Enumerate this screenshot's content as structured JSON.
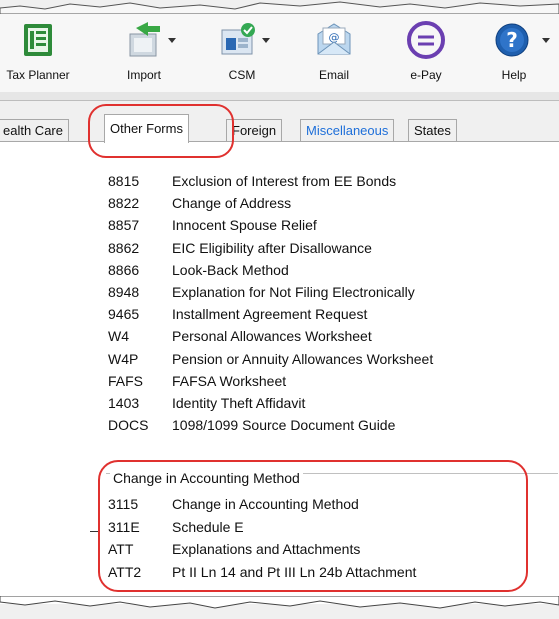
{
  "toolbar": {
    "items": [
      {
        "label": "Tax Planner",
        "icon": "tax-planner-icon"
      },
      {
        "label": "Import",
        "icon": "import-icon"
      },
      {
        "label": "CSM",
        "icon": "csm-icon"
      },
      {
        "label": "Email",
        "icon": "email-icon"
      },
      {
        "label": "e-Pay",
        "icon": "epay-icon"
      },
      {
        "label": "Help",
        "icon": "help-icon"
      }
    ]
  },
  "tabs": [
    {
      "label": "ealth Care",
      "active": false,
      "color": "#111111"
    },
    {
      "label": "Other Forms",
      "active": true,
      "color": "#111111"
    },
    {
      "label": "Foreign",
      "active": false,
      "color": "#111111"
    },
    {
      "label": "Miscellaneous",
      "active": false,
      "color": "#1e6fd9"
    },
    {
      "label": "States",
      "active": false,
      "color": "#111111"
    }
  ],
  "forms": [
    {
      "code": "8815",
      "desc": "Exclusion of Interest from EE Bonds"
    },
    {
      "code": "8822",
      "desc": "Change of Address"
    },
    {
      "code": "8857",
      "desc": "Innocent Spouse Relief"
    },
    {
      "code": "8862",
      "desc": "EIC Eligibility after Disallowance"
    },
    {
      "code": "8866",
      "desc": "Look-Back Method"
    },
    {
      "code": "8948",
      "desc": "Explanation for Not Filing Electronically"
    },
    {
      "code": "9465",
      "desc": "Installment Agreement Request"
    },
    {
      "code": "W4",
      "desc": "Personal Allowances Worksheet"
    },
    {
      "code": "W4P",
      "desc": "Pension or Annuity Allowances Worksheet"
    },
    {
      "code": "FAFS",
      "desc": "FAFSA Worksheet"
    },
    {
      "code": "1403",
      "desc": "Identity Theft Affidavit"
    },
    {
      "code": "DOCS",
      "desc": "1098/1099 Source Document Guide"
    }
  ],
  "accounting_group": {
    "title": "Change in Accounting Method",
    "items": [
      {
        "code": "3115",
        "desc": "Change in Accounting Method"
      },
      {
        "code": "311E",
        "desc": "Schedule E"
      },
      {
        "code": "ATT",
        "desc": "Explanations and Attachments"
      },
      {
        "code": "ATT2",
        "desc": "Pt II Ln 14 and Pt III Ln 24b Attachment"
      }
    ]
  },
  "colors": {
    "callout": "#e0312f",
    "link_blue": "#1e6fd9"
  }
}
